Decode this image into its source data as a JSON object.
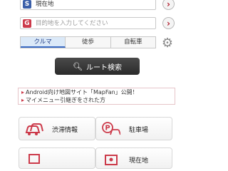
{
  "route": {
    "start": {
      "badge": "S",
      "value": "現在地"
    },
    "goal": {
      "badge": "G",
      "placeholder": "目的地を入力してください"
    },
    "modes": [
      {
        "label": "クルマ",
        "active": true
      },
      {
        "label": "徒歩",
        "active": false
      },
      {
        "label": "自転車",
        "active": false
      }
    ],
    "search_label": "ルート検索"
  },
  "notices": [
    "Android向け地図サイト「MapFan」公開！",
    "マイメニュー引継ぎをされた方"
  ],
  "menu": [
    {
      "label": "渋滞情報",
      "icon": "traffic-car-icon"
    },
    {
      "label": "駐車場",
      "icon": "parking-icon"
    },
    {
      "label": "",
      "icon": "screen-icon"
    },
    {
      "label": "現在地",
      "icon": "current-location-icon"
    }
  ],
  "colors": {
    "accent_red": "#cc3a4a",
    "accent_blue": "#3b5fa8",
    "tab_active": "#dbe9f8"
  }
}
